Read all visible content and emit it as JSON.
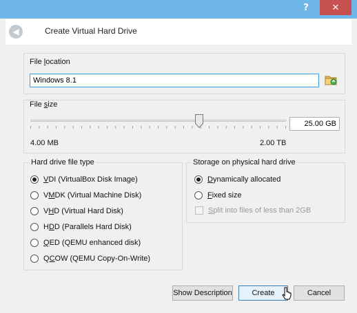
{
  "titlebar": {
    "help_label": "?",
    "close_glyph": "✕"
  },
  "header": {
    "title": "Create Virtual Hard Drive",
    "back_glyph": "◀"
  },
  "file_location": {
    "label_pre": "File ",
    "label_u": "l",
    "label_post": "ocation",
    "value": "Windows 8.1",
    "folder_icon": "folder-icon"
  },
  "file_size": {
    "label_pre": "File ",
    "label_u": "s",
    "label_post": "ize",
    "value": "25.00 GB",
    "min_label": "4.00 MB",
    "max_label": "2.00 TB",
    "slider_fraction": 0.66
  },
  "file_type": {
    "title": "Hard drive file type",
    "options": [
      {
        "pre": "",
        "u": "V",
        "post": "DI (VirtualBox Disk Image)",
        "selected": true
      },
      {
        "pre": "V",
        "u": "M",
        "post": "DK (Virtual Machine Disk)",
        "selected": false
      },
      {
        "pre": "V",
        "u": "H",
        "post": "D (Virtual Hard Disk)",
        "selected": false
      },
      {
        "pre": "H",
        "u": "D",
        "post": "D (Parallels Hard Disk)",
        "selected": false
      },
      {
        "pre": "",
        "u": "Q",
        "post": "ED (QEMU enhanced disk)",
        "selected": false
      },
      {
        "pre": "Q",
        "u": "C",
        "post": "OW (QEMU Copy-On-Write)",
        "selected": false
      }
    ]
  },
  "storage": {
    "title": "Storage on physical hard drive",
    "options": [
      {
        "pre": "",
        "u": "D",
        "post": "ynamically allocated",
        "selected": true
      },
      {
        "pre": "",
        "u": "F",
        "post": "ixed size",
        "selected": false
      }
    ],
    "split_label_pre": "",
    "split_label_u": "S",
    "split_label_post": "plit into files of less than 2GB",
    "split_checked": false
  },
  "buttons": {
    "show_description": "Show Description",
    "create": "Create",
    "cancel": "Cancel"
  },
  "colors": {
    "titlebar": "#6fb7e8",
    "close": "#c75050",
    "focus_border": "#3c9ae0"
  }
}
